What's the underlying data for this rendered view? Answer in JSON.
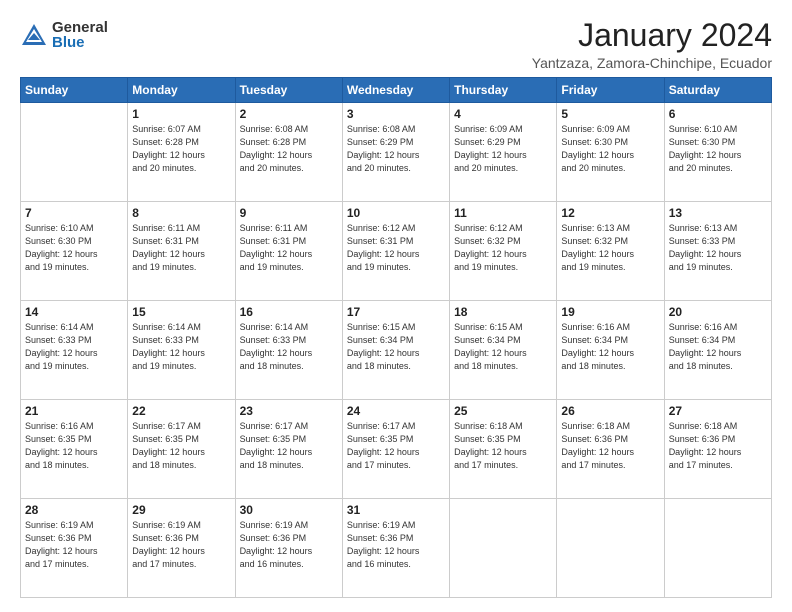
{
  "header": {
    "logo_general": "General",
    "logo_blue": "Blue",
    "month_title": "January 2024",
    "location": "Yantzaza, Zamora-Chinchipe, Ecuador"
  },
  "weekdays": [
    "Sunday",
    "Monday",
    "Tuesday",
    "Wednesday",
    "Thursday",
    "Friday",
    "Saturday"
  ],
  "weeks": [
    [
      {
        "day": "",
        "info": ""
      },
      {
        "day": "1",
        "info": "Sunrise: 6:07 AM\nSunset: 6:28 PM\nDaylight: 12 hours\nand 20 minutes."
      },
      {
        "day": "2",
        "info": "Sunrise: 6:08 AM\nSunset: 6:28 PM\nDaylight: 12 hours\nand 20 minutes."
      },
      {
        "day": "3",
        "info": "Sunrise: 6:08 AM\nSunset: 6:29 PM\nDaylight: 12 hours\nand 20 minutes."
      },
      {
        "day": "4",
        "info": "Sunrise: 6:09 AM\nSunset: 6:29 PM\nDaylight: 12 hours\nand 20 minutes."
      },
      {
        "day": "5",
        "info": "Sunrise: 6:09 AM\nSunset: 6:30 PM\nDaylight: 12 hours\nand 20 minutes."
      },
      {
        "day": "6",
        "info": "Sunrise: 6:10 AM\nSunset: 6:30 PM\nDaylight: 12 hours\nand 20 minutes."
      }
    ],
    [
      {
        "day": "7",
        "info": "Sunrise: 6:10 AM\nSunset: 6:30 PM\nDaylight: 12 hours\nand 19 minutes."
      },
      {
        "day": "8",
        "info": "Sunrise: 6:11 AM\nSunset: 6:31 PM\nDaylight: 12 hours\nand 19 minutes."
      },
      {
        "day": "9",
        "info": "Sunrise: 6:11 AM\nSunset: 6:31 PM\nDaylight: 12 hours\nand 19 minutes."
      },
      {
        "day": "10",
        "info": "Sunrise: 6:12 AM\nSunset: 6:31 PM\nDaylight: 12 hours\nand 19 minutes."
      },
      {
        "day": "11",
        "info": "Sunrise: 6:12 AM\nSunset: 6:32 PM\nDaylight: 12 hours\nand 19 minutes."
      },
      {
        "day": "12",
        "info": "Sunrise: 6:13 AM\nSunset: 6:32 PM\nDaylight: 12 hours\nand 19 minutes."
      },
      {
        "day": "13",
        "info": "Sunrise: 6:13 AM\nSunset: 6:33 PM\nDaylight: 12 hours\nand 19 minutes."
      }
    ],
    [
      {
        "day": "14",
        "info": "Sunrise: 6:14 AM\nSunset: 6:33 PM\nDaylight: 12 hours\nand 19 minutes."
      },
      {
        "day": "15",
        "info": "Sunrise: 6:14 AM\nSunset: 6:33 PM\nDaylight: 12 hours\nand 19 minutes."
      },
      {
        "day": "16",
        "info": "Sunrise: 6:14 AM\nSunset: 6:33 PM\nDaylight: 12 hours\nand 18 minutes."
      },
      {
        "day": "17",
        "info": "Sunrise: 6:15 AM\nSunset: 6:34 PM\nDaylight: 12 hours\nand 18 minutes."
      },
      {
        "day": "18",
        "info": "Sunrise: 6:15 AM\nSunset: 6:34 PM\nDaylight: 12 hours\nand 18 minutes."
      },
      {
        "day": "19",
        "info": "Sunrise: 6:16 AM\nSunset: 6:34 PM\nDaylight: 12 hours\nand 18 minutes."
      },
      {
        "day": "20",
        "info": "Sunrise: 6:16 AM\nSunset: 6:34 PM\nDaylight: 12 hours\nand 18 minutes."
      }
    ],
    [
      {
        "day": "21",
        "info": "Sunrise: 6:16 AM\nSunset: 6:35 PM\nDaylight: 12 hours\nand 18 minutes."
      },
      {
        "day": "22",
        "info": "Sunrise: 6:17 AM\nSunset: 6:35 PM\nDaylight: 12 hours\nand 18 minutes."
      },
      {
        "day": "23",
        "info": "Sunrise: 6:17 AM\nSunset: 6:35 PM\nDaylight: 12 hours\nand 18 minutes."
      },
      {
        "day": "24",
        "info": "Sunrise: 6:17 AM\nSunset: 6:35 PM\nDaylight: 12 hours\nand 17 minutes."
      },
      {
        "day": "25",
        "info": "Sunrise: 6:18 AM\nSunset: 6:35 PM\nDaylight: 12 hours\nand 17 minutes."
      },
      {
        "day": "26",
        "info": "Sunrise: 6:18 AM\nSunset: 6:36 PM\nDaylight: 12 hours\nand 17 minutes."
      },
      {
        "day": "27",
        "info": "Sunrise: 6:18 AM\nSunset: 6:36 PM\nDaylight: 12 hours\nand 17 minutes."
      }
    ],
    [
      {
        "day": "28",
        "info": "Sunrise: 6:19 AM\nSunset: 6:36 PM\nDaylight: 12 hours\nand 17 minutes."
      },
      {
        "day": "29",
        "info": "Sunrise: 6:19 AM\nSunset: 6:36 PM\nDaylight: 12 hours\nand 17 minutes."
      },
      {
        "day": "30",
        "info": "Sunrise: 6:19 AM\nSunset: 6:36 PM\nDaylight: 12 hours\nand 16 minutes."
      },
      {
        "day": "31",
        "info": "Sunrise: 6:19 AM\nSunset: 6:36 PM\nDaylight: 12 hours\nand 16 minutes."
      },
      {
        "day": "",
        "info": ""
      },
      {
        "day": "",
        "info": ""
      },
      {
        "day": "",
        "info": ""
      }
    ]
  ]
}
